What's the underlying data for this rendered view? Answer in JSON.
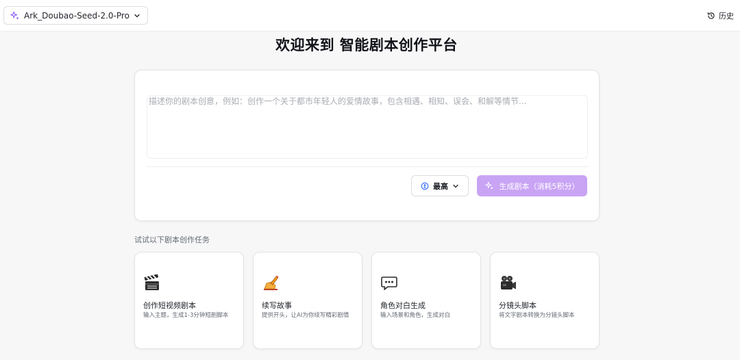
{
  "header": {
    "model_label": "Ark_Doubao-Seed-2.0-Pro",
    "history_label": "历史"
  },
  "main": {
    "title": "欢迎来到 智能剧本创作平台",
    "prompt": {
      "placeholder": "描述你的剧本创意，例如：创作一个关于都市年轻人的爱情故事，包含相遇、相知、误会、和解等情节...",
      "value": ""
    },
    "level_select": {
      "value": "最高"
    },
    "generate_button": {
      "label": "生成剧本（消耗5积分）"
    }
  },
  "tasks": {
    "section_label": "试试以下剧本创作任务",
    "items": [
      {
        "icon": "clapperboard-icon",
        "title": "创作短视频剧本",
        "desc": "输入主题，生成1-3分钟短剧脚本"
      },
      {
        "icon": "writing-hand-icon",
        "title": "续写故事",
        "desc": "提供开头，让AI为你续写精彩剧情"
      },
      {
        "icon": "speech-bubble-icon",
        "title": "角色对白生成",
        "desc": "输入场景和角色，生成对白"
      },
      {
        "icon": "movie-camera-icon",
        "title": "分镜头脚本",
        "desc": "将文字剧本转换为分镜头脚本"
      }
    ]
  },
  "colors": {
    "accent": "#7c3aed",
    "generate_button_bg": "#c9a4f4",
    "page_bg": "#f7f7f8"
  }
}
